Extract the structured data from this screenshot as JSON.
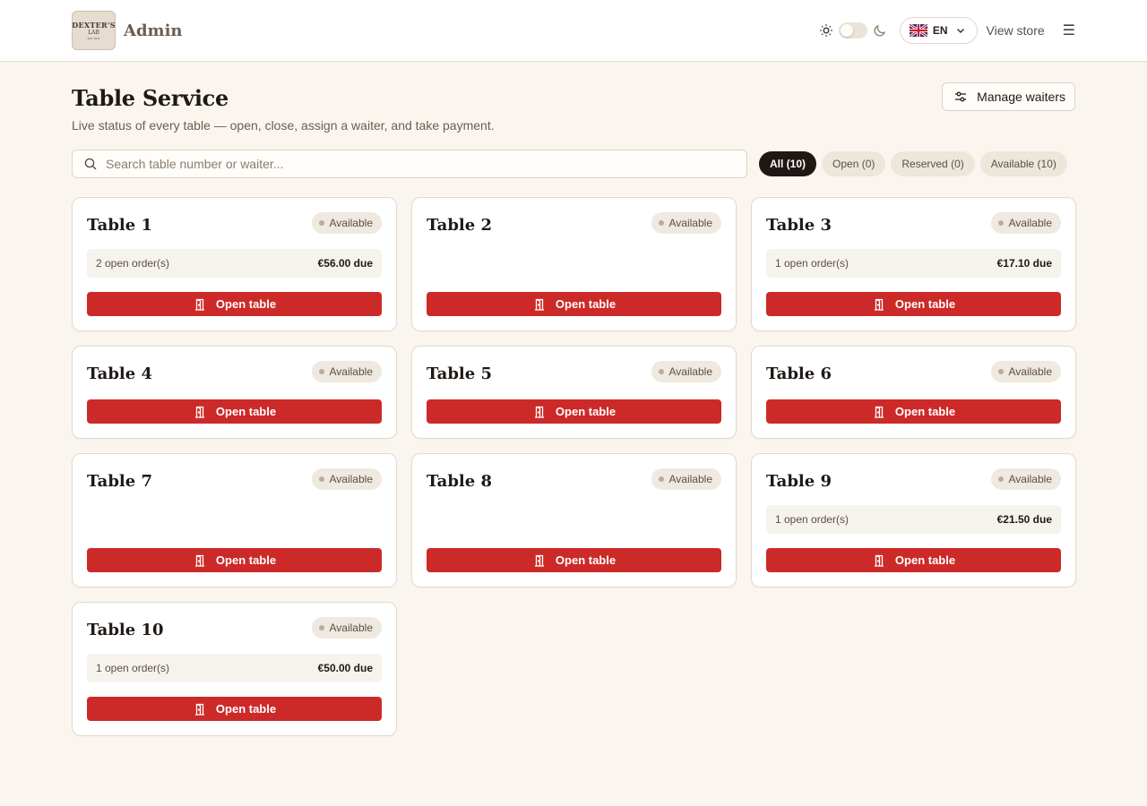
{
  "header": {
    "logo_text": [
      "DEXTER'S",
      "LAB",
      "EST. 2021"
    ],
    "brand": "Admin",
    "language": "EN",
    "view_store": "View store"
  },
  "page": {
    "title": "Table Service",
    "subtitle": "Live status of every table — open, close, assign a waiter, and take payment.",
    "manage_waiters": "Manage waiters"
  },
  "search": {
    "placeholder": "Search table number or waiter..."
  },
  "filters": [
    {
      "label": "All (10)",
      "active": true
    },
    {
      "label": "Open (0)",
      "active": false
    },
    {
      "label": "Reserved (0)",
      "active": false
    },
    {
      "label": "Available (10)",
      "active": false
    }
  ],
  "tables": [
    {
      "name": "Table 1",
      "status": "Available",
      "orders": "2 open order(s)",
      "due": "€56.00 due",
      "button": "Open table"
    },
    {
      "name": "Table 2",
      "status": "Available",
      "orders": "",
      "due": "",
      "button": "Open table"
    },
    {
      "name": "Table 3",
      "status": "Available",
      "orders": "1 open order(s)",
      "due": "€17.10 due",
      "button": "Open table"
    },
    {
      "name": "Table 4",
      "status": "Available",
      "orders": "",
      "due": "",
      "button": "Open table"
    },
    {
      "name": "Table 5",
      "status": "Available",
      "orders": "",
      "due": "",
      "button": "Open table"
    },
    {
      "name": "Table 6",
      "status": "Available",
      "orders": "",
      "due": "",
      "button": "Open table"
    },
    {
      "name": "Table 7",
      "status": "Available",
      "orders": "",
      "due": "",
      "button": "Open table"
    },
    {
      "name": "Table 8",
      "status": "Available",
      "orders": "",
      "due": "",
      "button": "Open table"
    },
    {
      "name": "Table 9",
      "status": "Available",
      "orders": "1 open order(s)",
      "due": "€21.50 due",
      "button": "Open table"
    },
    {
      "name": "Table 10",
      "status": "Available",
      "orders": "1 open order(s)",
      "due": "€50.00 due",
      "button": "Open table"
    }
  ],
  "colors": {
    "accent": "#cc2a29",
    "background": "#faf6ef",
    "chip_active": "#1f1713"
  }
}
